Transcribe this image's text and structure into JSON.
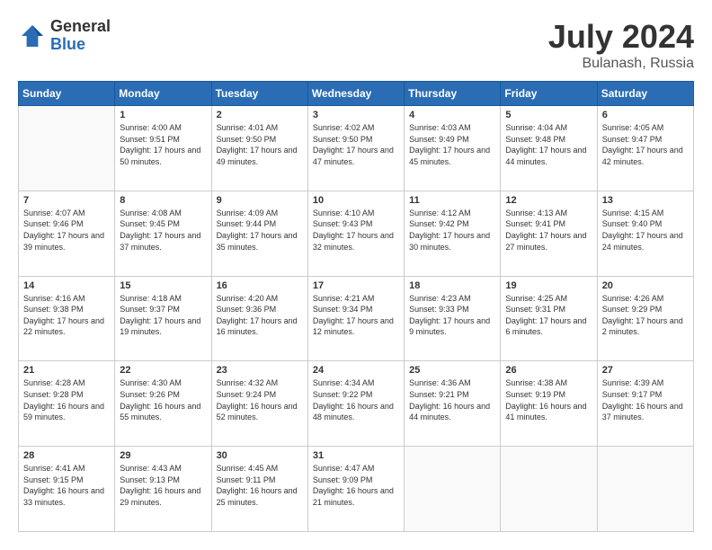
{
  "logo": {
    "general": "General",
    "blue": "Blue"
  },
  "header": {
    "month_year": "July 2024",
    "location": "Bulanash, Russia"
  },
  "weekdays": [
    "Sunday",
    "Monday",
    "Tuesday",
    "Wednesday",
    "Thursday",
    "Friday",
    "Saturday"
  ],
  "weeks": [
    [
      {
        "day": "",
        "sunrise": "",
        "sunset": "",
        "daylight": ""
      },
      {
        "day": "1",
        "sunrise": "Sunrise: 4:00 AM",
        "sunset": "Sunset: 9:51 PM",
        "daylight": "Daylight: 17 hours and 50 minutes."
      },
      {
        "day": "2",
        "sunrise": "Sunrise: 4:01 AM",
        "sunset": "Sunset: 9:50 PM",
        "daylight": "Daylight: 17 hours and 49 minutes."
      },
      {
        "day": "3",
        "sunrise": "Sunrise: 4:02 AM",
        "sunset": "Sunset: 9:50 PM",
        "daylight": "Daylight: 17 hours and 47 minutes."
      },
      {
        "day": "4",
        "sunrise": "Sunrise: 4:03 AM",
        "sunset": "Sunset: 9:49 PM",
        "daylight": "Daylight: 17 hours and 45 minutes."
      },
      {
        "day": "5",
        "sunrise": "Sunrise: 4:04 AM",
        "sunset": "Sunset: 9:48 PM",
        "daylight": "Daylight: 17 hours and 44 minutes."
      },
      {
        "day": "6",
        "sunrise": "Sunrise: 4:05 AM",
        "sunset": "Sunset: 9:47 PM",
        "daylight": "Daylight: 17 hours and 42 minutes."
      }
    ],
    [
      {
        "day": "7",
        "sunrise": "Sunrise: 4:07 AM",
        "sunset": "Sunset: 9:46 PM",
        "daylight": "Daylight: 17 hours and 39 minutes."
      },
      {
        "day": "8",
        "sunrise": "Sunrise: 4:08 AM",
        "sunset": "Sunset: 9:45 PM",
        "daylight": "Daylight: 17 hours and 37 minutes."
      },
      {
        "day": "9",
        "sunrise": "Sunrise: 4:09 AM",
        "sunset": "Sunset: 9:44 PM",
        "daylight": "Daylight: 17 hours and 35 minutes."
      },
      {
        "day": "10",
        "sunrise": "Sunrise: 4:10 AM",
        "sunset": "Sunset: 9:43 PM",
        "daylight": "Daylight: 17 hours and 32 minutes."
      },
      {
        "day": "11",
        "sunrise": "Sunrise: 4:12 AM",
        "sunset": "Sunset: 9:42 PM",
        "daylight": "Daylight: 17 hours and 30 minutes."
      },
      {
        "day": "12",
        "sunrise": "Sunrise: 4:13 AM",
        "sunset": "Sunset: 9:41 PM",
        "daylight": "Daylight: 17 hours and 27 minutes."
      },
      {
        "day": "13",
        "sunrise": "Sunrise: 4:15 AM",
        "sunset": "Sunset: 9:40 PM",
        "daylight": "Daylight: 17 hours and 24 minutes."
      }
    ],
    [
      {
        "day": "14",
        "sunrise": "Sunrise: 4:16 AM",
        "sunset": "Sunset: 9:38 PM",
        "daylight": "Daylight: 17 hours and 22 minutes."
      },
      {
        "day": "15",
        "sunrise": "Sunrise: 4:18 AM",
        "sunset": "Sunset: 9:37 PM",
        "daylight": "Daylight: 17 hours and 19 minutes."
      },
      {
        "day": "16",
        "sunrise": "Sunrise: 4:20 AM",
        "sunset": "Sunset: 9:36 PM",
        "daylight": "Daylight: 17 hours and 16 minutes."
      },
      {
        "day": "17",
        "sunrise": "Sunrise: 4:21 AM",
        "sunset": "Sunset: 9:34 PM",
        "daylight": "Daylight: 17 hours and 12 minutes."
      },
      {
        "day": "18",
        "sunrise": "Sunrise: 4:23 AM",
        "sunset": "Sunset: 9:33 PM",
        "daylight": "Daylight: 17 hours and 9 minutes."
      },
      {
        "day": "19",
        "sunrise": "Sunrise: 4:25 AM",
        "sunset": "Sunset: 9:31 PM",
        "daylight": "Daylight: 17 hours and 6 minutes."
      },
      {
        "day": "20",
        "sunrise": "Sunrise: 4:26 AM",
        "sunset": "Sunset: 9:29 PM",
        "daylight": "Daylight: 17 hours and 2 minutes."
      }
    ],
    [
      {
        "day": "21",
        "sunrise": "Sunrise: 4:28 AM",
        "sunset": "Sunset: 9:28 PM",
        "daylight": "Daylight: 16 hours and 59 minutes."
      },
      {
        "day": "22",
        "sunrise": "Sunrise: 4:30 AM",
        "sunset": "Sunset: 9:26 PM",
        "daylight": "Daylight: 16 hours and 55 minutes."
      },
      {
        "day": "23",
        "sunrise": "Sunrise: 4:32 AM",
        "sunset": "Sunset: 9:24 PM",
        "daylight": "Daylight: 16 hours and 52 minutes."
      },
      {
        "day": "24",
        "sunrise": "Sunrise: 4:34 AM",
        "sunset": "Sunset: 9:22 PM",
        "daylight": "Daylight: 16 hours and 48 minutes."
      },
      {
        "day": "25",
        "sunrise": "Sunrise: 4:36 AM",
        "sunset": "Sunset: 9:21 PM",
        "daylight": "Daylight: 16 hours and 44 minutes."
      },
      {
        "day": "26",
        "sunrise": "Sunrise: 4:38 AM",
        "sunset": "Sunset: 9:19 PM",
        "daylight": "Daylight: 16 hours and 41 minutes."
      },
      {
        "day": "27",
        "sunrise": "Sunrise: 4:39 AM",
        "sunset": "Sunset: 9:17 PM",
        "daylight": "Daylight: 16 hours and 37 minutes."
      }
    ],
    [
      {
        "day": "28",
        "sunrise": "Sunrise: 4:41 AM",
        "sunset": "Sunset: 9:15 PM",
        "daylight": "Daylight: 16 hours and 33 minutes."
      },
      {
        "day": "29",
        "sunrise": "Sunrise: 4:43 AM",
        "sunset": "Sunset: 9:13 PM",
        "daylight": "Daylight: 16 hours and 29 minutes."
      },
      {
        "day": "30",
        "sunrise": "Sunrise: 4:45 AM",
        "sunset": "Sunset: 9:11 PM",
        "daylight": "Daylight: 16 hours and 25 minutes."
      },
      {
        "day": "31",
        "sunrise": "Sunrise: 4:47 AM",
        "sunset": "Sunset: 9:09 PM",
        "daylight": "Daylight: 16 hours and 21 minutes."
      },
      {
        "day": "",
        "sunrise": "",
        "sunset": "",
        "daylight": ""
      },
      {
        "day": "",
        "sunrise": "",
        "sunset": "",
        "daylight": ""
      },
      {
        "day": "",
        "sunrise": "",
        "sunset": "",
        "daylight": ""
      }
    ]
  ]
}
